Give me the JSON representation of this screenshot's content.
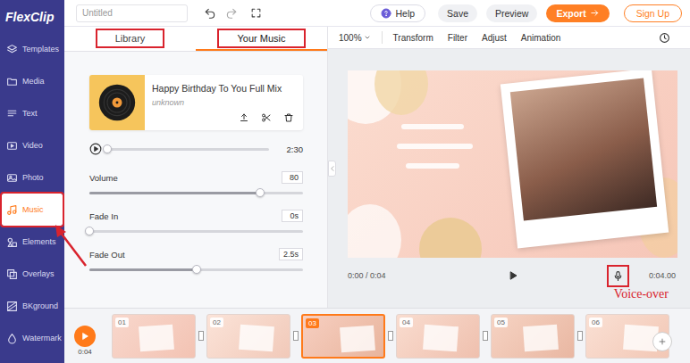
{
  "logo": {
    "text": "FlexClip"
  },
  "top_bar": {
    "project_title": "Untitled",
    "help": "Help",
    "save": "Save",
    "preview": "Preview",
    "export": "Export",
    "sign_up": "Sign Up"
  },
  "sidebar": {
    "items": [
      {
        "label": "Templates",
        "selected": false
      },
      {
        "label": "Media",
        "selected": false
      },
      {
        "label": "Text",
        "selected": false
      },
      {
        "label": "Video",
        "selected": false
      },
      {
        "label": "Photo",
        "selected": false
      },
      {
        "label": "Music",
        "selected": true
      },
      {
        "label": "Elements",
        "selected": false
      },
      {
        "label": "Overlays",
        "selected": false
      },
      {
        "label": "BKground",
        "selected": false
      },
      {
        "label": "Watermark",
        "selected": false
      }
    ]
  },
  "panel": {
    "tabs": [
      {
        "label": "Library",
        "selected": false
      },
      {
        "label": "Your Music",
        "selected": true
      }
    ],
    "track": {
      "title": "Happy Birthday To You Full Mix",
      "artist": "unknown",
      "duration": "2:30",
      "level": 0
    },
    "settings": [
      {
        "label": "Volume",
        "value": "80",
        "level": 0.8
      },
      {
        "label": "Fade In",
        "value": "0s",
        "level": 0
      },
      {
        "label": "Fade Out",
        "value": "2.5s",
        "level": 0.5
      }
    ]
  },
  "editor_toolbar": {
    "zoom": "100%",
    "items": [
      "Transform",
      "Filter",
      "Adjust",
      "Animation"
    ]
  },
  "player": {
    "time": "0:00 / 0:04",
    "duration": "0:04.00"
  },
  "annotation": {
    "label": "Voice-over"
  },
  "timeline": {
    "time": "0:04",
    "clips": [
      {
        "number": "01",
        "selected": false
      },
      {
        "number": "02",
        "selected": false
      },
      {
        "number": "03",
        "selected": true
      },
      {
        "number": "04",
        "selected": false
      },
      {
        "number": "05",
        "selected": false
      },
      {
        "number": "06",
        "selected": false
      }
    ]
  }
}
